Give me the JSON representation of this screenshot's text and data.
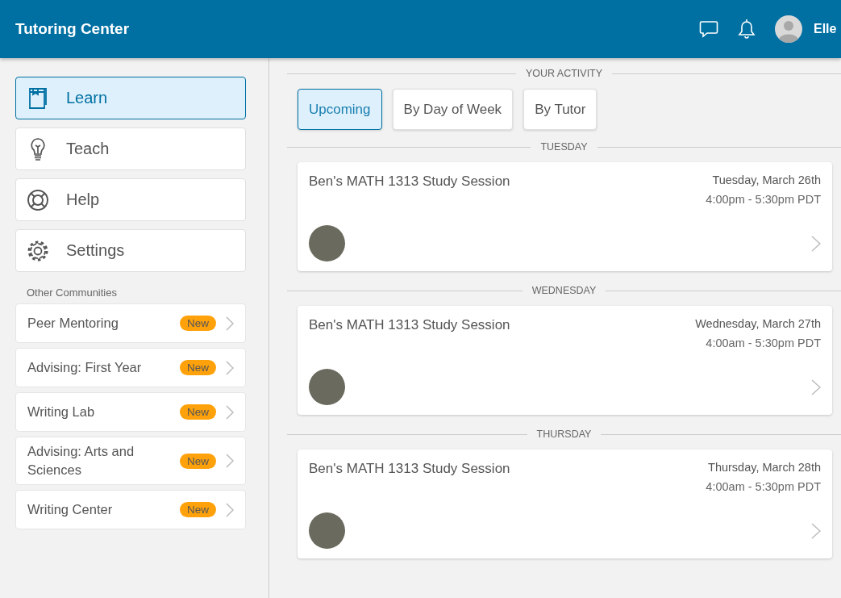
{
  "header": {
    "title": "Tutoring Center",
    "user_name": "Elle"
  },
  "nav": [
    {
      "label": "Learn",
      "kind": "book",
      "selected": true
    },
    {
      "label": "Teach",
      "kind": "bulb",
      "selected": false
    },
    {
      "label": "Help",
      "kind": "lifebuoy",
      "selected": false
    },
    {
      "label": "Settings",
      "kind": "gear",
      "selected": false
    }
  ],
  "communities": {
    "heading": "Other Communities",
    "items": [
      {
        "label": "Peer Mentoring",
        "badge": "New"
      },
      {
        "label": "Advising: First Year",
        "badge": "New"
      },
      {
        "label": "Writing Lab",
        "badge": "New"
      },
      {
        "label": "Advising: Arts and Sciences",
        "badge": "New"
      },
      {
        "label": "Writing Center",
        "badge": "New"
      }
    ]
  },
  "activity": {
    "heading": "YOUR ACTIVITY",
    "tabs": [
      {
        "label": "Upcoming",
        "selected": true
      },
      {
        "label": "By Day of Week",
        "selected": false
      },
      {
        "label": "By Tutor",
        "selected": false
      }
    ],
    "days": [
      {
        "day": "TUESDAY",
        "sessions": [
          {
            "title": "Ben's MATH 1313 Study Session",
            "date": "Tuesday, March 26th",
            "time": "4:00pm - 5:30pm PDT"
          }
        ]
      },
      {
        "day": "WEDNESDAY",
        "sessions": [
          {
            "title": "Ben's MATH 1313 Study Session",
            "date": "Wednesday, March 27th",
            "time": "4:00am - 5:30pm PDT"
          }
        ]
      },
      {
        "day": "THURSDAY",
        "sessions": [
          {
            "title": "Ben's MATH 1313 Study Session",
            "date": "Thursday, March 28th",
            "time": "4:00am - 5:30pm PDT"
          }
        ]
      }
    ]
  }
}
